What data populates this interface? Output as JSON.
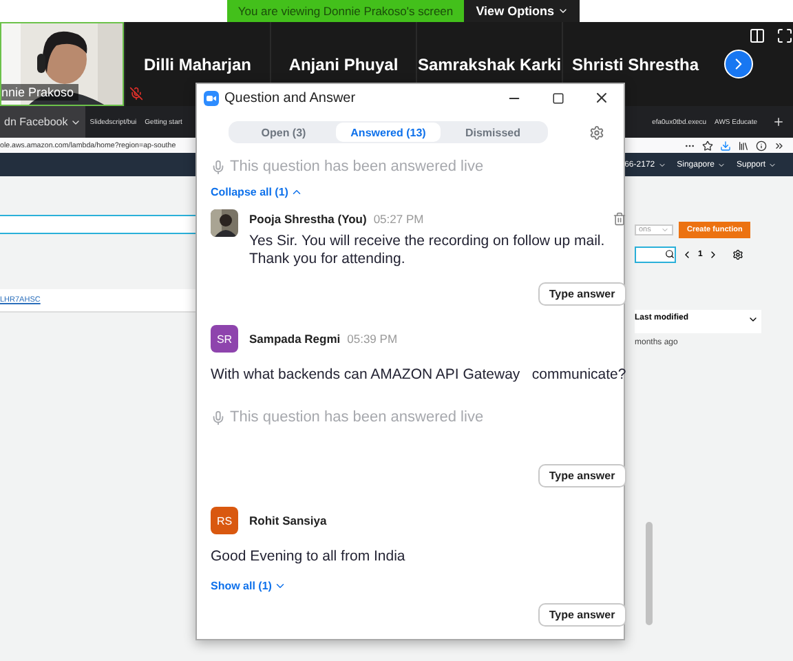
{
  "share_banner": {
    "text": "You are viewing Donnie Prakoso's screen",
    "options_button": "View Options"
  },
  "participants": [
    {
      "kind": "video",
      "name": "nnie Prakoso",
      "muted": true
    },
    {
      "kind": "name",
      "name": "Dilli Maharjan"
    },
    {
      "kind": "name",
      "name": "Anjani Phuyal"
    },
    {
      "kind": "name",
      "name": "Samrakshak Karki"
    },
    {
      "kind": "name",
      "name": "Shristi Shrestha"
    }
  ],
  "shared_screen": {
    "browser_tabs": [
      {
        "label": "dn Facebook",
        "selected": true
      },
      {
        "label": "Slidedscript/bui",
        "selected": false
      },
      {
        "label": "Getting start",
        "selected": false
      },
      {
        "label": "efa0ux0tbd.execu",
        "selected": false
      },
      {
        "label": "AWS Educate",
        "selected": false
      }
    ],
    "url": "ole.aws.amazon.com/lambda/home?region=ap-southe",
    "nav_items": [
      "66-2172",
      "Singapore",
      "Support"
    ],
    "function_link": "LHR7AHSC",
    "filter": "ons",
    "create_button": "Create function",
    "page": "1",
    "column": "Last modified",
    "cell": "months ago"
  },
  "qa_window": {
    "title": "Question and Answer",
    "tabs": [
      {
        "label": "Open (3)",
        "selected": false
      },
      {
        "label": "Answered (13)",
        "selected": true
      },
      {
        "label": "Dismissed",
        "selected": false
      }
    ],
    "items": [
      {
        "kind": "note",
        "text": "This question has been answered live"
      },
      {
        "kind": "toggle",
        "label": "Collapse all (1)",
        "expanded": true
      },
      {
        "kind": "answer",
        "author": "Pooja Shrestha (You)",
        "time": "05:27 PM",
        "text": "Yes Sir. You will receive the recording on follow up mail. Thank you for attending."
      },
      {
        "kind": "button",
        "label": "Type answer"
      },
      {
        "kind": "question",
        "author": "Sampada Regmi",
        "initials": "SR",
        "color": "#8e44ad",
        "time": "05:39 PM",
        "text": "With what backends can AMAZON API Gateway   communicate?"
      },
      {
        "kind": "note",
        "text": "This question has been answered live"
      },
      {
        "kind": "button",
        "label": "Type answer"
      },
      {
        "kind": "question",
        "author": "Rohit Sansiya",
        "initials": "RS",
        "color": "#d9580f",
        "text": "Good Evening to all from India"
      },
      {
        "kind": "toggle",
        "label": "Show all (1)",
        "expanded": false
      },
      {
        "kind": "button",
        "label": "Type answer"
      }
    ]
  }
}
